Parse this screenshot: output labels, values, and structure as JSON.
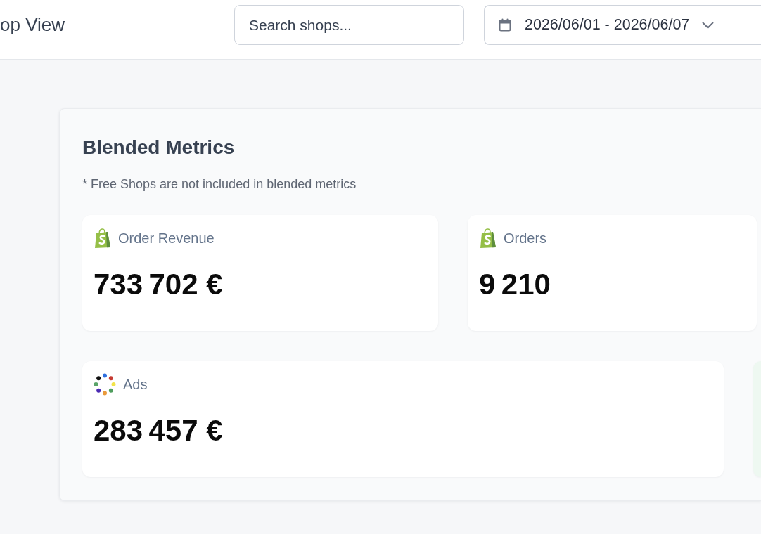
{
  "header": {
    "title": "op View",
    "search": {
      "placeholder": "Search shops..."
    },
    "date_range": {
      "label": "2026/06/01 - 2026/06/07"
    }
  },
  "panel": {
    "title": "Blended Metrics",
    "note": "* Free Shops are not included in blended metrics",
    "metrics": [
      {
        "kind": "shop",
        "label": "Order Revenue",
        "value": "733 702 €"
      },
      {
        "kind": "shop",
        "label": "Orders",
        "value": "9 210"
      },
      {
        "kind": "ads",
        "label": "Ads",
        "value": "283 457 €"
      },
      {
        "kind": "highlight"
      }
    ]
  }
}
